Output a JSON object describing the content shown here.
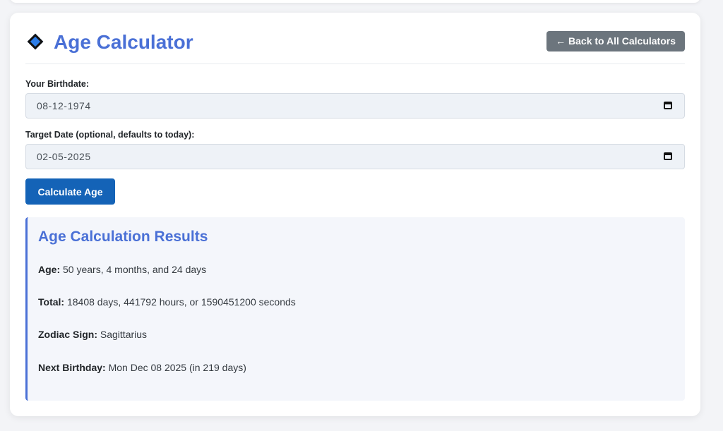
{
  "header": {
    "title": "Age Calculator",
    "back_button": "← Back to All Calculators"
  },
  "form": {
    "birthdate_label": "Your Birthdate:",
    "birthdate_value": "08-12-1974",
    "target_label": "Target Date (optional, defaults to today):",
    "target_value": "02-05-2025",
    "calculate_button": "Calculate Age"
  },
  "results": {
    "title": "Age Calculation Results",
    "age_label": "Age:",
    "age_value": "50 years, 4 months, and 24 days",
    "total_label": "Total:",
    "total_value": "18408 days, 441792 hours, or 1590451200 seconds",
    "zodiac_label": "Zodiac Sign:",
    "zodiac_value": "Sagittarius",
    "next_birthday_label": "Next Birthday:",
    "next_birthday_value": "Mon Dec 08 2025 (in 219 days)"
  },
  "icons": {
    "title_icon": "diamond-icon",
    "date_picker_icon": "calendar-icon"
  },
  "colors": {
    "accent": "#4a70d6",
    "primary_button": "#1463b7",
    "secondary_button": "#6c757d"
  }
}
